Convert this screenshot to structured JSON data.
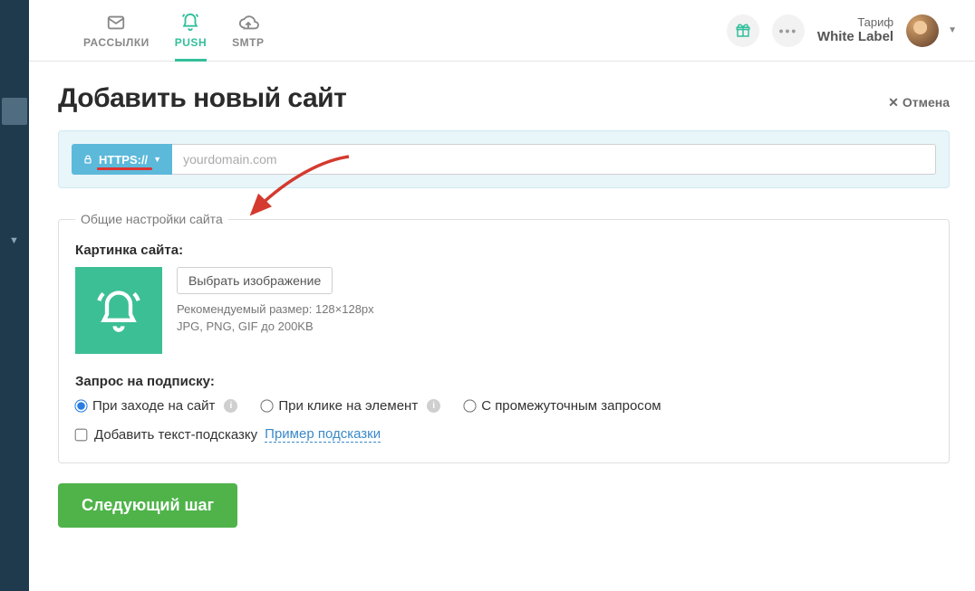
{
  "nav": {
    "tabs": [
      {
        "label": "РАССЫЛКИ"
      },
      {
        "label": "PUSH"
      },
      {
        "label": "SMTP"
      }
    ],
    "tarif_label": "Тариф",
    "plan_name": "White Label"
  },
  "page": {
    "title": "Добавить новый сайт",
    "cancel": "Отмена"
  },
  "url": {
    "protocol": "HTTPS://",
    "placeholder": "yourdomain.com",
    "value": ""
  },
  "settings": {
    "legend": "Общие настройки сайта",
    "image_label": "Картинка сайта:",
    "choose_btn": "Выбрать изображение",
    "hint_line1": "Рекомендуемый размер: 128×128px",
    "hint_line2": "JPG, PNG, GIF до 200KB",
    "subscribe_label": "Запрос на подписку:",
    "radios": {
      "on_visit": "При заходе на сайт",
      "on_click": "При клике на элемент",
      "with_intermediate": "С промежуточным запросом"
    },
    "hint_checkbox": "Добавить текст-подсказку",
    "hint_example_link": "Пример подсказки"
  },
  "actions": {
    "next": "Следующий шаг"
  },
  "colors": {
    "accent_green": "#3cbf95",
    "accent_blue": "#5cb9da",
    "primary_button": "#4fb34a",
    "annotation_red": "#d43a2f"
  }
}
